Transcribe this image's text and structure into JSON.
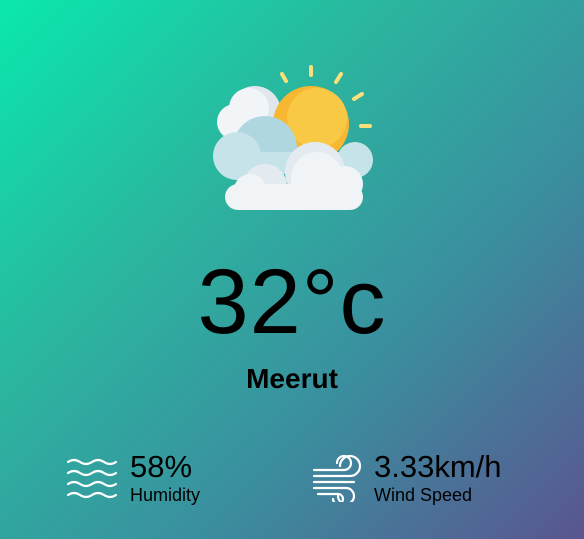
{
  "weather": {
    "icon": "partly-cloudy-sun-icon",
    "temperature": "32°c",
    "city": "Meerut"
  },
  "details": {
    "humidity": {
      "icon": "humidity-waves-icon",
      "value": "58%",
      "label": "Humidity"
    },
    "wind": {
      "icon": "wind-icon",
      "value": "3.33km/h",
      "label": "Wind Speed"
    }
  },
  "colors": {
    "gradient_start": "#0ae8ad",
    "gradient_end": "#5a5590",
    "sun": "#f7b731",
    "cloud": "#eef3f6"
  }
}
